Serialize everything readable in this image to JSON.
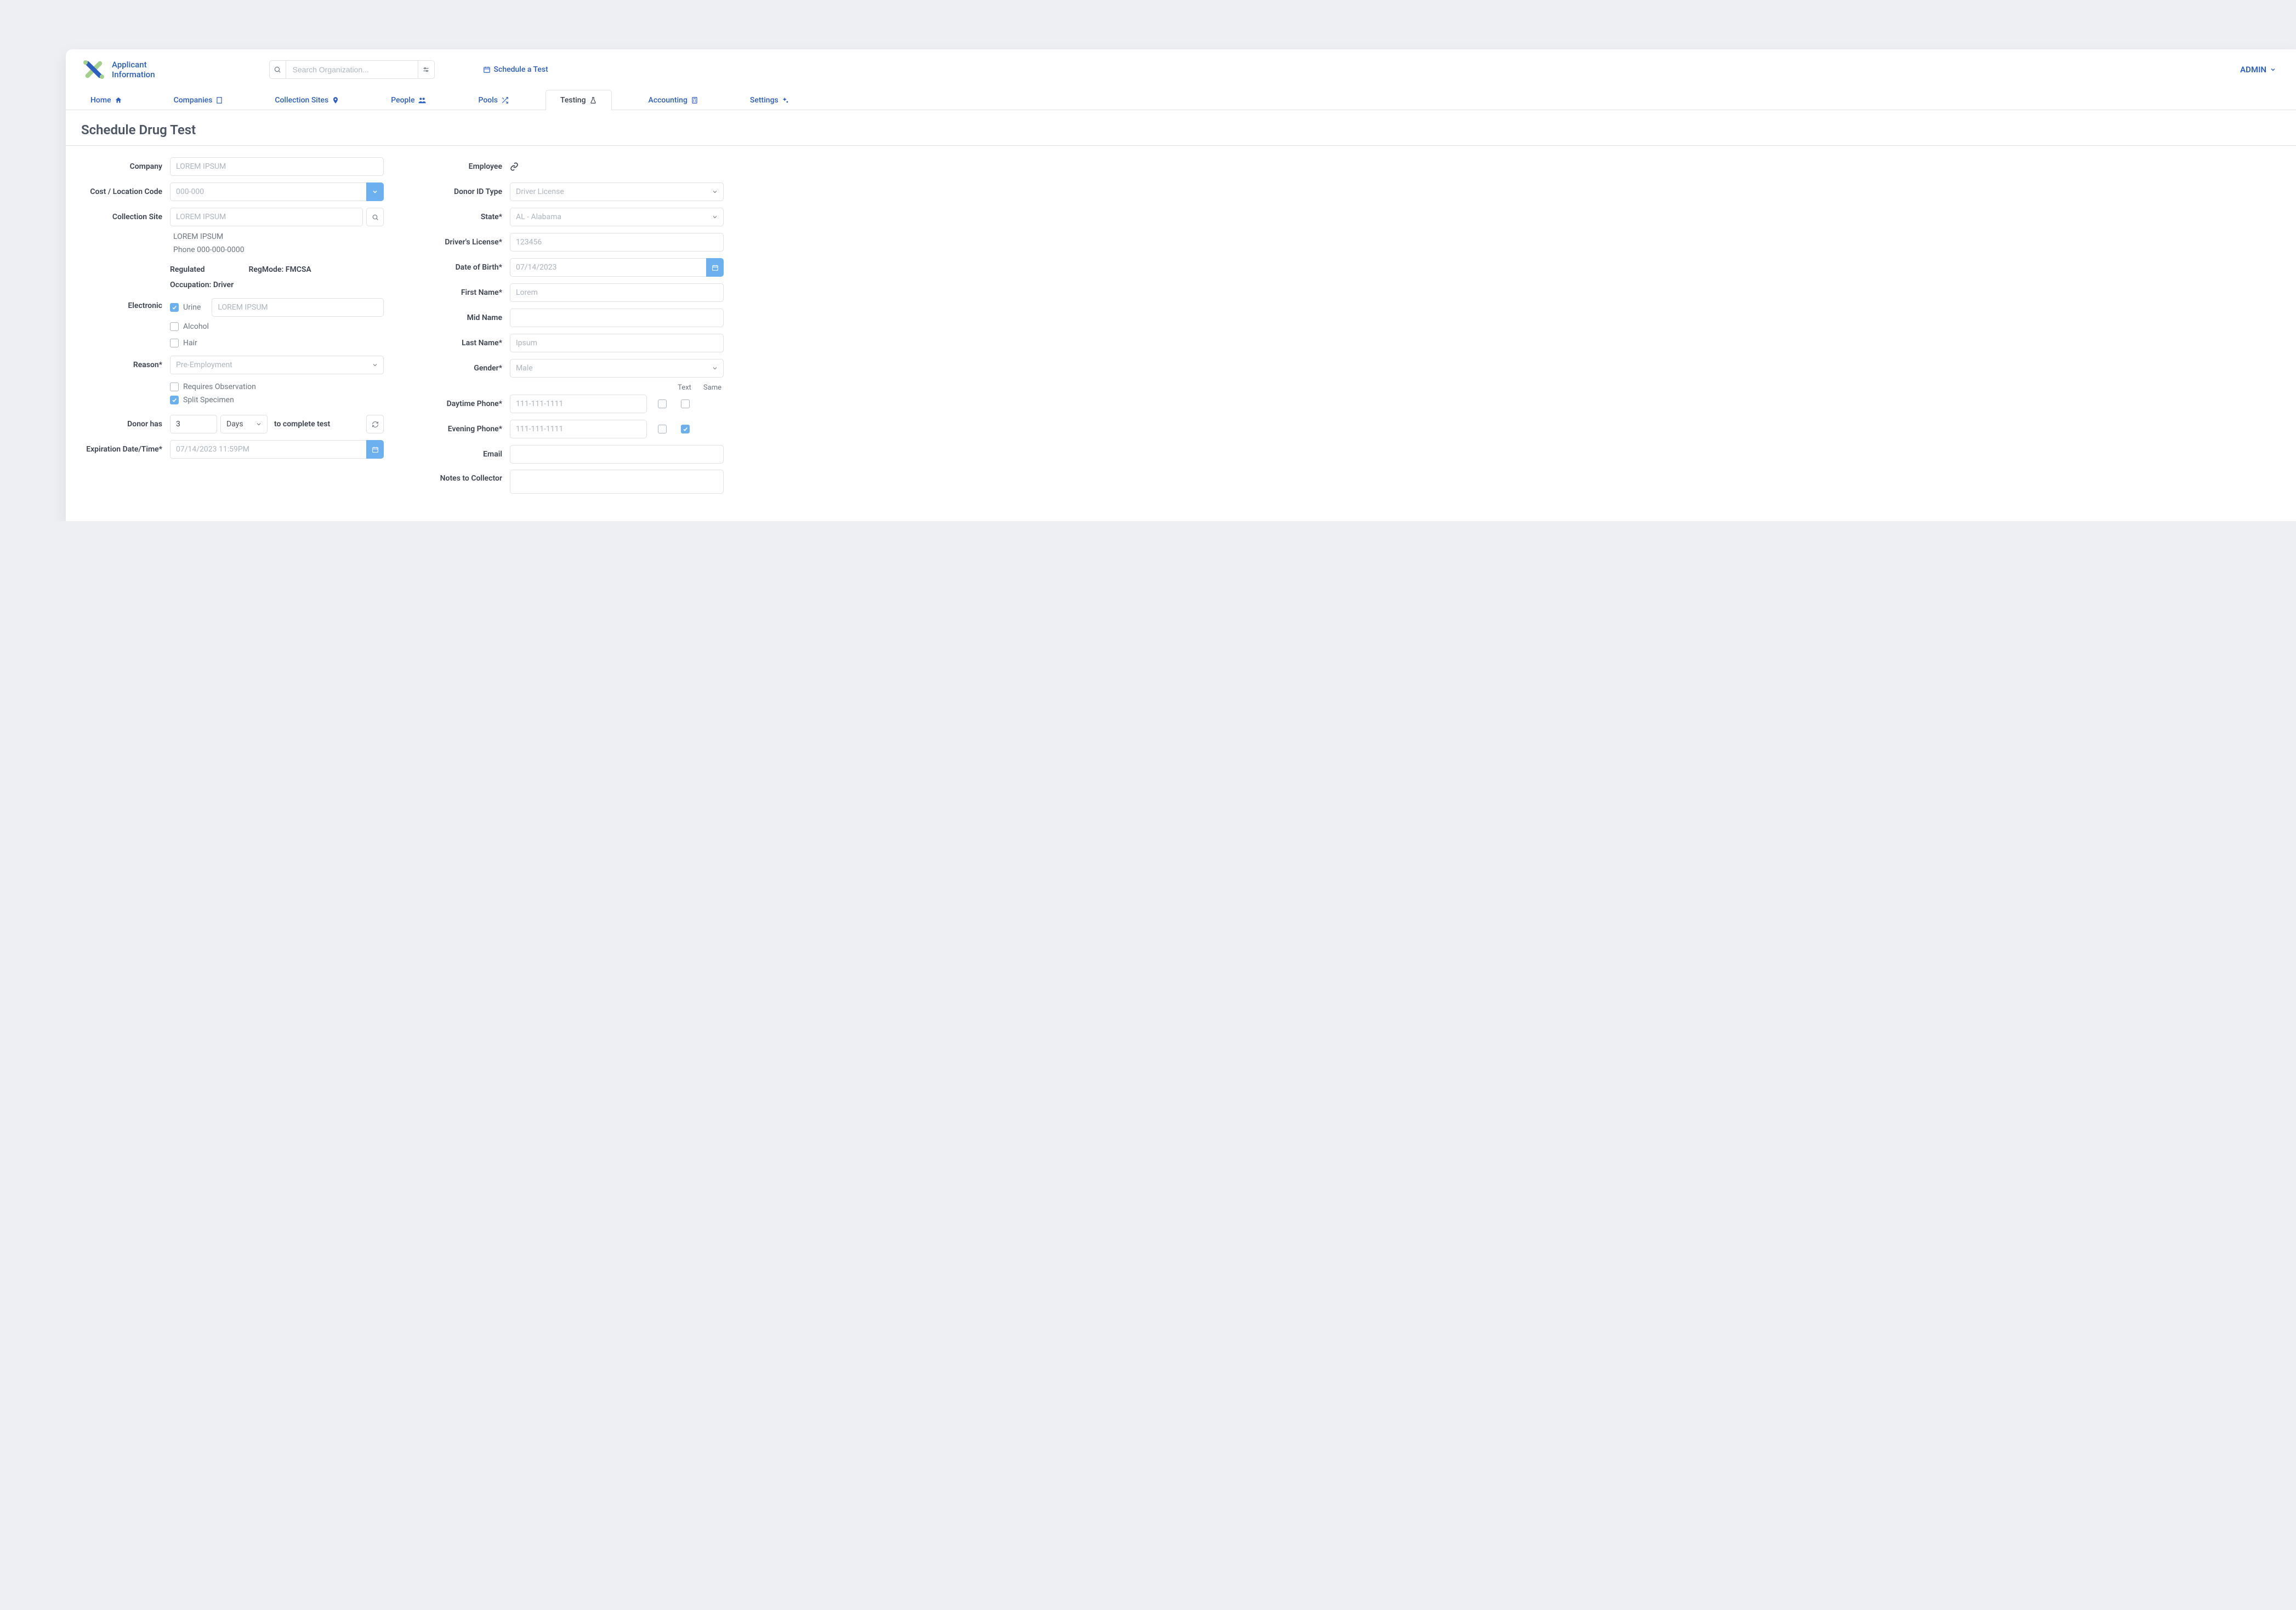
{
  "brand": {
    "line1": "Applicant",
    "line2": "Information"
  },
  "search": {
    "placeholder": "Search Organization..."
  },
  "header_links": {
    "schedule": "Schedule a Test",
    "admin": "ADMIN"
  },
  "nav": [
    {
      "label": "Home",
      "icon": "home"
    },
    {
      "label": "Companies",
      "icon": "building"
    },
    {
      "label": "Collection Sites",
      "icon": "pin"
    },
    {
      "label": "People",
      "icon": "users"
    },
    {
      "label": "Pools",
      "icon": "shuffle"
    },
    {
      "label": "Testing",
      "icon": "flask",
      "active": true
    },
    {
      "label": "Accounting",
      "icon": "calc"
    },
    {
      "label": "Settings",
      "icon": "gears"
    }
  ],
  "page_title": "Schedule Drug Test",
  "left": {
    "company": {
      "label": "Company",
      "value": "",
      "placeholder": "LOREM IPSUM"
    },
    "cost_code": {
      "label": "Cost / Location Code",
      "value": "000-000"
    },
    "collection_site": {
      "label": "Collection Site",
      "value": "",
      "placeholder": "LOREM IPSUM",
      "detail_line1": "LOREM IPSUM",
      "detail_line2": "Phone 000-000-0000"
    },
    "regulated_text": "Regulated",
    "regmode_text": "RegMode: FMCSA",
    "occupation_text": "Occupation: Driver",
    "electronic": {
      "label": "Electronic",
      "urine": "Urine",
      "alcohol": "Alcohol",
      "hair": "Hair",
      "side_placeholder": "LOREM IPSUM"
    },
    "reason": {
      "label": "Reason*",
      "value": "Pre-Employment"
    },
    "requires_obs": "Requires Observation",
    "split_specimen": "Split Specimen",
    "donor_has": {
      "label": "Donor has",
      "qty": "3",
      "unit": "Days",
      "suffix": "to complete test"
    },
    "expiration": {
      "label": "Expiration Date/Time*",
      "value": "07/14/2023 11:59PM"
    }
  },
  "right": {
    "employee": {
      "label": "Employee"
    },
    "donor_id_type": {
      "label": "Donor ID Type",
      "value": "Driver License"
    },
    "state": {
      "label": "State*",
      "value": "AL - Alabama"
    },
    "driver_license": {
      "label": "Driver's License*",
      "placeholder": "123456"
    },
    "dob": {
      "label": "Date of Birth*",
      "placeholder": "07/14/2023"
    },
    "first_name": {
      "label": "First Name*",
      "placeholder": "Lorem"
    },
    "mid_name": {
      "label": "Mid Name"
    },
    "last_name": {
      "label": "Last Name*",
      "placeholder": "Ipsum"
    },
    "gender": {
      "label": "Gender*",
      "value": "Male"
    },
    "col_text": "Text",
    "col_same": "Same",
    "daytime_phone": {
      "label": "Daytime Phone*",
      "placeholder": "111-111-1111"
    },
    "evening_phone": {
      "label": "Evening Phone*",
      "placeholder": "111-111-1111"
    },
    "email": {
      "label": "Email"
    },
    "notes": {
      "label": "Notes to Collector"
    }
  }
}
